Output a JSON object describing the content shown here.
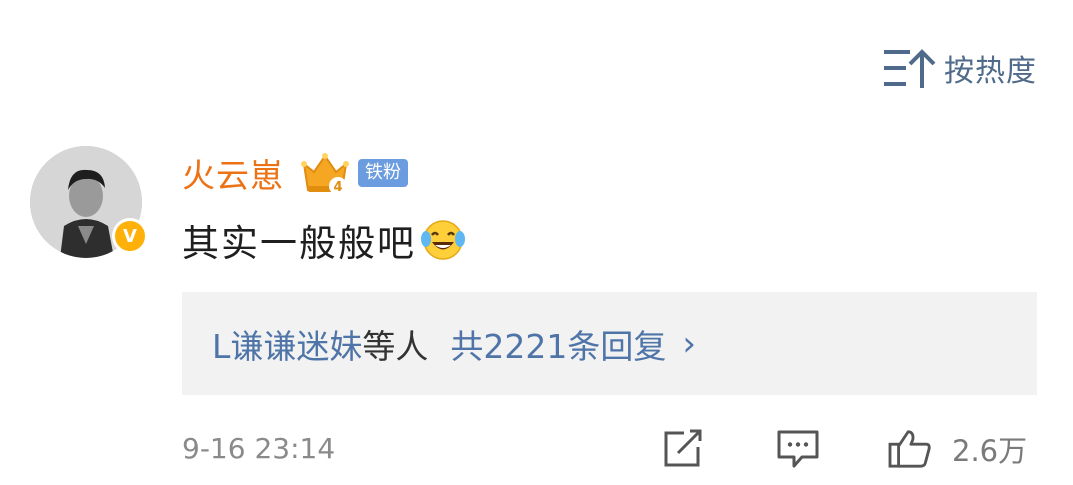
{
  "sort": {
    "label": "按热度",
    "icon": "sort-up-icon"
  },
  "comment": {
    "avatar_icon": "user-avatar",
    "verified_icon": "verified-v-badge",
    "verified_label": "V",
    "username": "火云崽",
    "crown_icon": "crown-level-4-icon",
    "crown_level": "4",
    "fan_badge": "铁粉",
    "text": "其实一般般吧",
    "emoji_icon": "laugh-cry-emoji",
    "colors": {
      "username": "#ec7216",
      "link": "#4e74a8",
      "badge": "#6c9ce0",
      "crown": "#f5a623",
      "verified": "#ffb10a"
    }
  },
  "replies": {
    "users": "L谦谦迷妹",
    "suffix": "等人",
    "total": "共2221条回复",
    "chevron": "›"
  },
  "footer": {
    "time": "9-16 23:14",
    "share_icon": "share-icon",
    "comment_icon": "comment-icon",
    "like_icon": "thumbs-up-icon",
    "like_count": "2.6万"
  }
}
